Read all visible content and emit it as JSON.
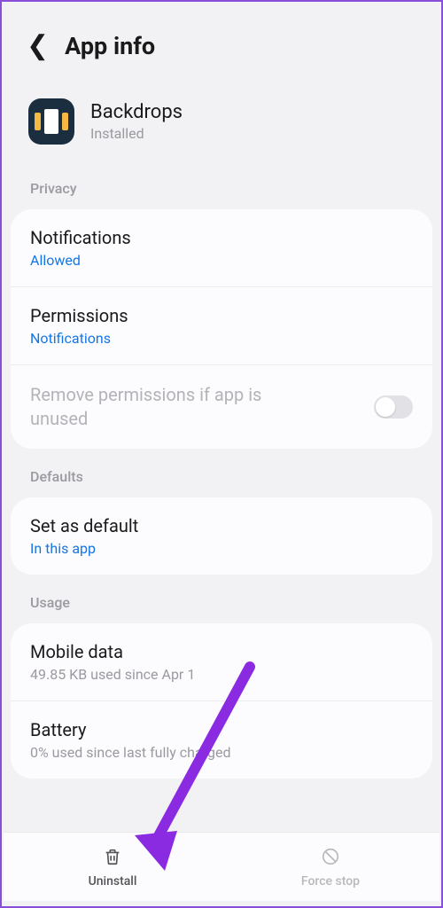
{
  "header": {
    "title": "App info"
  },
  "app": {
    "name": "Backdrops",
    "status": "Installed"
  },
  "sections": {
    "privacy": {
      "label": "Privacy",
      "notifications": {
        "title": "Notifications",
        "value": "Allowed"
      },
      "permissions": {
        "title": "Permissions",
        "value": "Notifications"
      },
      "remove_perms": {
        "title": "Remove permissions if app is unused"
      }
    },
    "defaults": {
      "label": "Defaults",
      "set_default": {
        "title": "Set as default",
        "value": "In this app"
      }
    },
    "usage": {
      "label": "Usage",
      "mobile_data": {
        "title": "Mobile data",
        "value": "49.85 KB used since Apr 1"
      },
      "battery": {
        "title": "Battery",
        "value": "0% used since last fully charged"
      }
    }
  },
  "bottom": {
    "uninstall": "Uninstall",
    "force_stop": "Force stop"
  }
}
